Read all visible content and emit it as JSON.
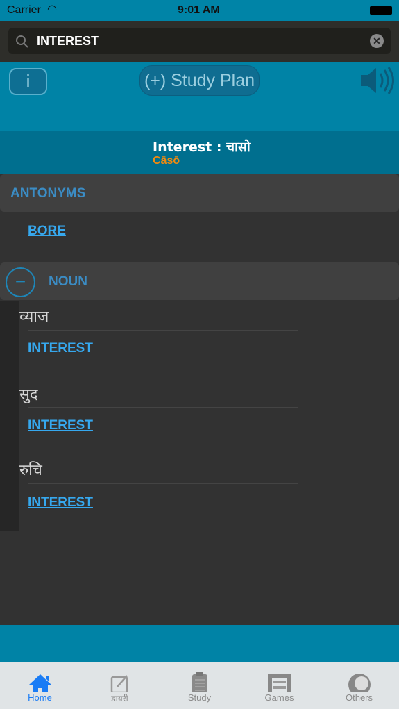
{
  "status_bar": {
    "carrier": "Carrier",
    "time": "9:01 AM"
  },
  "search": {
    "value": "INTEREST"
  },
  "toolbar": {
    "info_label": "i",
    "study_plan_label": "(+) Study Plan"
  },
  "header": {
    "title": "Interest : चासो",
    "transliteration": "Cāsō"
  },
  "antonyms": {
    "title": "ANTONYMS",
    "items": [
      "BORE"
    ]
  },
  "noun": {
    "title": "NOUN",
    "meanings": [
      {
        "word": "व्याज",
        "link": "INTEREST"
      },
      {
        "word": "सुद",
        "link": "INTEREST"
      },
      {
        "word": "रुचि",
        "link": "INTEREST"
      }
    ]
  },
  "tabs": [
    {
      "label": "Home",
      "icon": "home-icon",
      "active": true
    },
    {
      "label": "डायरी",
      "icon": "edit-icon"
    },
    {
      "label": "Study",
      "icon": "clipboard-icon"
    },
    {
      "label": "Games",
      "icon": "abacus-icon"
    },
    {
      "label": "Others",
      "icon": "others-icon"
    }
  ],
  "colors": {
    "accent": "#0083a6",
    "link": "#36a8ee",
    "active_tab": "#1a7cf5",
    "transliteration": "#f08a10"
  }
}
